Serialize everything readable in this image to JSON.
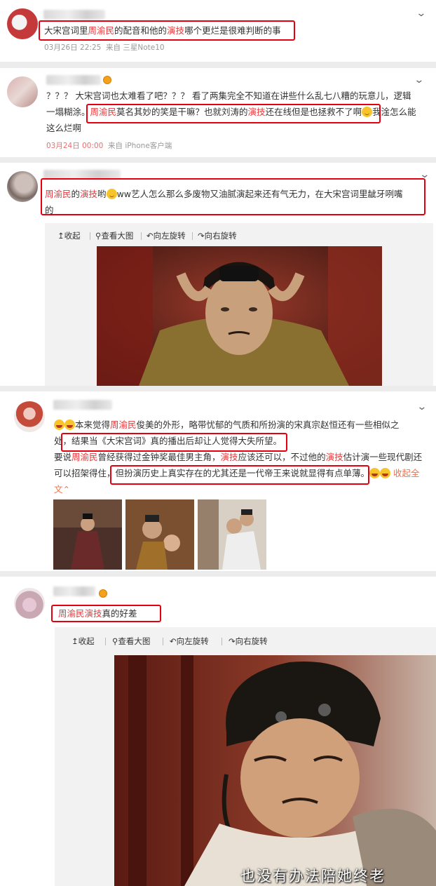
{
  "posts": [
    {
      "text_prefix": "大宋宫词里",
      "name": "周渝民",
      "text_mid": "的配音和他的",
      "acting": "演技",
      "text_suffix": "哪个更烂是很难判断的事",
      "date": "03月26日 22:25",
      "source": "来自 三星Note10"
    },
    {
      "line1": "？？？ 大宋宫词也太难看了吧？？？ 看了两集完全不知道在讲些什么乱七八糟的玩意儿，逻辑",
      "line2_a": "一塌糊涂。",
      "line2_name": "周渝民",
      "line2_b": "莫名其妙的笑是干嘛？也就刘涛的",
      "line2_acting": "演技",
      "line2_c": "还在线但是也拯救不了啊",
      "line2_d": "我淦怎么能",
      "line3": "这么烂啊",
      "date": "03月24日 00:00",
      "source": "来自 iPhone客户端"
    },
    {
      "name": "周渝民",
      "text_a": "的",
      "acting": "演技",
      "text_b": "哟",
      "text_c": "ww艺人怎么那么多废物又油腻演起来还有气无力，在大宋宫词里龇牙咧嘴",
      "line2": "的",
      "toolbar": [
        "收起",
        "查看大图",
        "向左旋转",
        "向右旋转"
      ]
    },
    {
      "l1_a": "本来觉得",
      "l1_name": "周渝民",
      "l1_b": "俊美的外形，略带忧郁的气质和所扮演的宋真宗赵恒还有一些相似之",
      "l2_a": "处，",
      "l2_b": "结果当《大宋宫词》真的播出后却让人觉得大失所望。",
      "l3_a": "要说",
      "l3_name": "周渝民",
      "l3_b": "曾经获得过金钟奖最佳男主角，",
      "l3_acting": "演技",
      "l3_c": "应该还可以，不过他的",
      "l3_acting2": "演技",
      "l3_d": "估计演一些现代剧还",
      "l4_a": "可以招架得住，",
      "l4_b": "但扮演历史上真实存在的尤其还是一代帝王来说就显得有点单薄。",
      "l4_c": "收起全",
      "l5": "文"
    },
    {
      "name": "周渝民",
      "acting": "演技",
      "text": "真的好差",
      "toolbar": [
        "收起",
        "查看大图",
        "向左旋转",
        "向右旋转"
      ],
      "subtitle": "也没有办法陪她终老"
    }
  ],
  "icons": [
    "chevron-down-icon",
    "collapse-icon",
    "search-icon",
    "rotate-left-icon",
    "rotate-right-icon",
    "crown-badge-icon"
  ],
  "colors": {
    "highlight": "#e3000f",
    "keyword": "#e5383b",
    "background": "#ececec"
  }
}
